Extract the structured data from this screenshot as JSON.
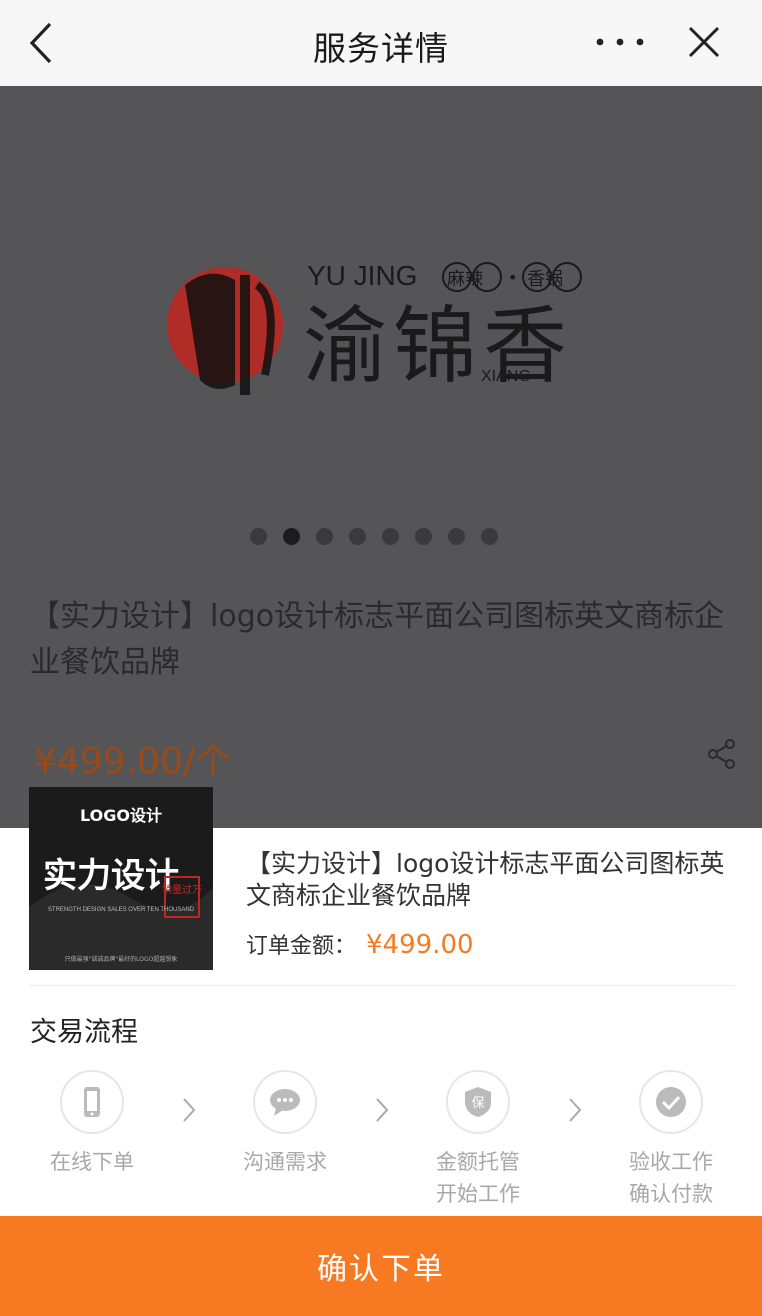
{
  "nav": {
    "title": "服务详情"
  },
  "product": {
    "carousel_total": 8,
    "carousel_active_index": 2,
    "hero_logo": {
      "brand_latin": "YU JING",
      "tag_left": "麻辣",
      "tag_sep": "•",
      "tag_right": "香锅",
      "brand_cn": "渝锦香",
      "brand_sub": "XIANG"
    },
    "title": "【实力设计】logo设计标志平面公司图标英文商标企业餐饮品牌",
    "price": "¥499.00/个"
  },
  "order": {
    "thumb": {
      "heading": "LOGO设计",
      "big": "实力设计",
      "seal": "销量过万",
      "sub": "STRENGTH DESIGN SALES OVER TEN THOUSAND",
      "footer": "只做最强\"诚诚品牌\"最好的LOGO超越想象"
    },
    "title": "【实力设计】logo设计标志平面公司图标英文商标企业餐饮品牌",
    "amount_label": "订单金额：",
    "amount_value": "¥499.00"
  },
  "flow": {
    "title": "交易流程",
    "steps": [
      {
        "icon": "phone-icon",
        "line1": "在线下单",
        "line2": ""
      },
      {
        "icon": "chat-icon",
        "line1": "沟通需求",
        "line2": ""
      },
      {
        "icon": "shield-icon",
        "badge": "保",
        "line1": "金额托管",
        "line2": "开始工作"
      },
      {
        "icon": "check-circle-icon",
        "line1": "验收工作",
        "line2": "确认付款"
      }
    ]
  },
  "confirm_label": "确认下单",
  "colors": {
    "accent": "#f77a23",
    "price": "#f47b22",
    "backdrop": "#555558",
    "logo_red": "#c0261f"
  }
}
